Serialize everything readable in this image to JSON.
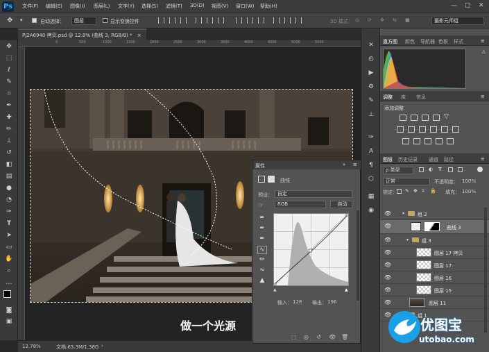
{
  "app": {
    "logo": "Ps",
    "menus": [
      "文件(F)",
      "编辑(E)",
      "图像(I)",
      "图层(L)",
      "文字(Y)",
      "选择(S)",
      "滤镜(T)",
      "3D(D)",
      "视图(V)",
      "窗口(W)",
      "帮助(H)"
    ],
    "window_controls": [
      "—",
      "□",
      "✕"
    ]
  },
  "options_bar": {
    "auto_select_label": "自动选择：",
    "auto_select_value": "图层",
    "show_transform_label": "显示变换控件",
    "mode_3d": "3D 模式：",
    "workspace": "摄影元师组"
  },
  "document": {
    "tab_title": "PJ2A6940 拷贝.psd @ 12.8% (曲线 3, RGB/8) *",
    "tab_close": "×",
    "ruler_ticks": [
      "0",
      "500",
      "1000",
      "1500",
      "2000",
      "2500",
      "3000",
      "3500",
      "4000",
      "4500",
      "5000",
      "5500"
    ],
    "caption": "做一个光源"
  },
  "status": {
    "zoom": "12.78%",
    "doc_info": "文档:63.3M/1.38G",
    "arrow": "›"
  },
  "properties": {
    "title": "属性",
    "menu_icon": "≡",
    "type_label": "曲线",
    "preset_label": "预设：",
    "preset_value": "自定",
    "channel_value": "RGB",
    "auto_button": "自动",
    "input_label": "输入：",
    "input_value": "128",
    "output_label": "输出：",
    "output_value": "196"
  },
  "icon_column": {
    "icons": [
      "close-x-icon",
      "wrench-icon",
      "pen-icon",
      "type-icon",
      "paragraph-icon",
      "3d-cube-icon",
      "channel-icon",
      "color-wheel-icon"
    ]
  },
  "histogram_panel": {
    "tabs": [
      "直方图",
      "颜色",
      "导航器",
      "色板",
      "样式"
    ],
    "menu_icon": "≡"
  },
  "adjustments_panel": {
    "tabs": [
      "调整",
      "库",
      "信息"
    ],
    "title": "添加调整",
    "menu_icon": "≡"
  },
  "layers_panel": {
    "tabs": [
      "图层",
      "历史记录",
      "通道",
      "路径"
    ],
    "menu_icon": "≡",
    "filter_label": "ρ 类型",
    "blend_mode": "正常",
    "opacity_label": "不透明度：",
    "opacity_value": "100%",
    "lock_label": "锁定：",
    "fill_label": "填充：",
    "fill_value": "100%",
    "rows": [
      {
        "name": "组 2",
        "type": "group",
        "indent": 1
      },
      {
        "name": "曲线 3",
        "type": "curves",
        "indent": 2,
        "selected": true
      },
      {
        "name": "组 3",
        "type": "group",
        "indent": 2
      },
      {
        "name": "图层 17 拷贝",
        "type": "layer",
        "indent": 3
      },
      {
        "name": "图层 17",
        "type": "layer",
        "indent": 3
      },
      {
        "name": "图层 16",
        "type": "layer",
        "indent": 3
      },
      {
        "name": "图层 15",
        "type": "layer",
        "indent": 3
      },
      {
        "name": "图层 11",
        "type": "photo",
        "indent": 1
      },
      {
        "name": "组 1",
        "type": "group",
        "indent": 1
      }
    ]
  },
  "watermark": {
    "brand": "优图宝",
    "url": "utobao.com"
  },
  "colors": {
    "accent": "#31a8ff",
    "panel": "#535353",
    "selected_row": "#6a6a6a"
  }
}
